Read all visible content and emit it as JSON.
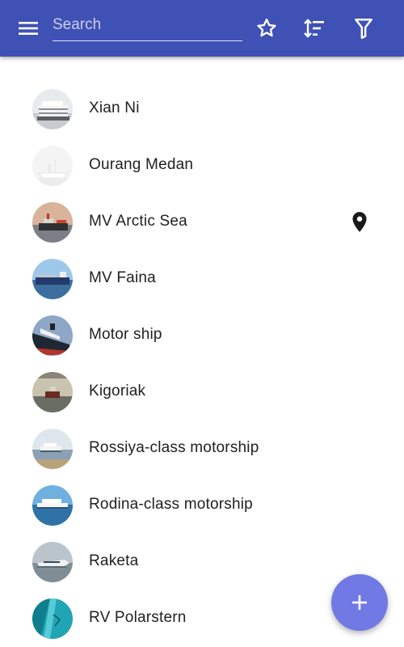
{
  "toolbar": {
    "search_placeholder": "Search",
    "menu_icon": "hamburger-menu-icon",
    "favorites_icon": "star-outline-icon",
    "sort_icon": "sort-icon",
    "filter_icon": "filter-icon",
    "bar_color": "#3f51b5"
  },
  "list": {
    "items": [
      {
        "label": "Xian Ni"
      },
      {
        "label": "Ourang Medan"
      },
      {
        "label": "MV Arctic Sea",
        "pin_icon": "location-pin-icon"
      },
      {
        "label": "MV Faina"
      },
      {
        "label": "Motor ship"
      },
      {
        "label": "Kigoriak"
      },
      {
        "label": "Rossiya-class motorship"
      },
      {
        "label": "Rodina-class motorship"
      },
      {
        "label": "Raketa"
      },
      {
        "label": "RV Polarstern"
      }
    ]
  },
  "fab": {
    "icon": "plus-icon",
    "color": "#7079e4"
  }
}
